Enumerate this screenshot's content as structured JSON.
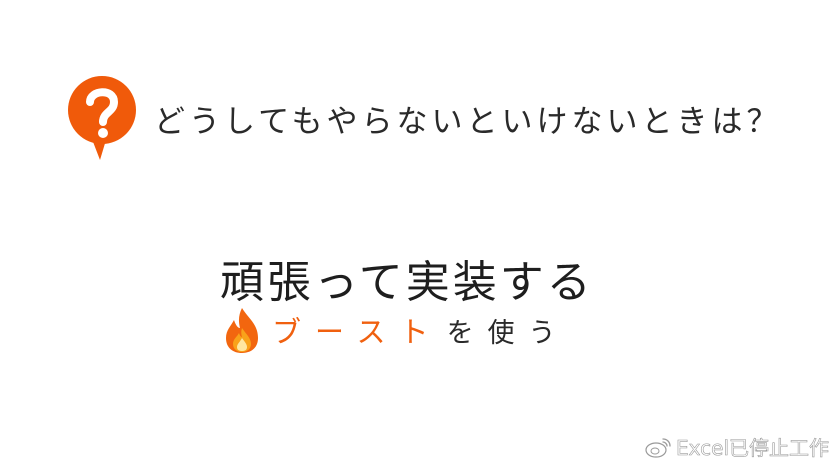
{
  "question": {
    "icon": "question-speech-bubble-icon",
    "text": "どうしてもやらないといけないときは？",
    "icon_color": "#f05a0a"
  },
  "answer": {
    "text": "頑張って実装する"
  },
  "boost": {
    "icon": "fire-icon",
    "highlight": "ブースト",
    "rest": "を使う",
    "highlight_color": "#f0600f"
  },
  "watermark": {
    "icon": "weibo-icon",
    "text": "Excel已停止工作"
  }
}
